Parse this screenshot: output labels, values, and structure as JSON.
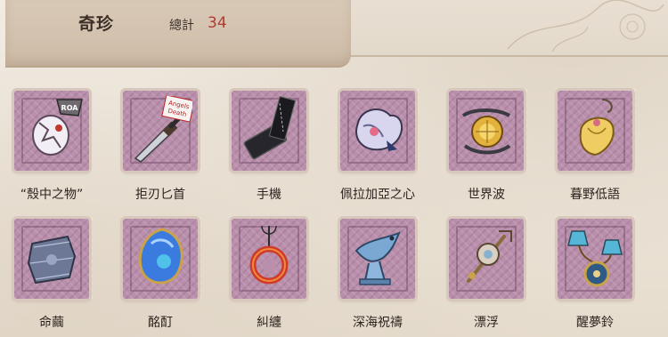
{
  "header": {
    "title": "奇珍",
    "total_label": "總計",
    "total_count": "34"
  },
  "items": [
    {
      "label": "“殼中之物”",
      "icon": "shell-creature-icon",
      "accent": "#e7e3ee"
    },
    {
      "label": "拒刃匕首",
      "icon": "dagger-icon",
      "accent": "#9aa0a8",
      "tag": "Angels Death"
    },
    {
      "label": "手機",
      "icon": "phone-icon",
      "accent": "#2a2a30"
    },
    {
      "label": "佩拉加亞之心",
      "icon": "heart-crystal-icon",
      "accent": "#c9c7e6"
    },
    {
      "label": "世界波",
      "icon": "world-orb-icon",
      "accent": "#d9a22a"
    },
    {
      "label": "暮野低語",
      "icon": "lantern-bloom-icon",
      "accent": "#e7c45a"
    },
    {
      "label": "命繭",
      "icon": "cocoon-box-icon",
      "accent": "#5d6a8a"
    },
    {
      "label": "酩酊",
      "icon": "blue-gem-icon",
      "accent": "#3a78d9"
    },
    {
      "label": "糾纏",
      "icon": "red-ring-pendant-icon",
      "accent": "#c9342a"
    },
    {
      "label": "深海祝禱",
      "icon": "fish-figurine-icon",
      "accent": "#6d9ec8"
    },
    {
      "label": "漂浮",
      "icon": "floating-key-icon",
      "accent": "#b08a57"
    },
    {
      "label": "醒夢鈴",
      "icon": "dream-bell-icon",
      "accent": "#4aa7c9"
    }
  ]
}
